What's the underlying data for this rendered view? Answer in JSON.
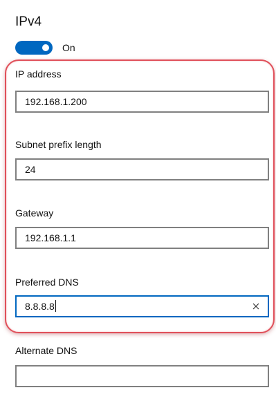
{
  "section_title": "IPv4",
  "toggle": {
    "label": "On",
    "state": "on",
    "accent_color": "#0067c0"
  },
  "fields": {
    "ip_address": {
      "label": "IP address",
      "value": "192.168.1.200"
    },
    "subnet_prefix_length": {
      "label": "Subnet prefix length",
      "value": "24"
    },
    "gateway": {
      "label": "Gateway",
      "value": "192.168.1.1"
    },
    "preferred_dns": {
      "label": "Preferred DNS",
      "value": "8.8.8.8",
      "focused": true
    },
    "alternate_dns": {
      "label": "Alternate DNS",
      "value": ""
    }
  },
  "clear_icon": "close-icon",
  "highlight_color": "#e0505a"
}
